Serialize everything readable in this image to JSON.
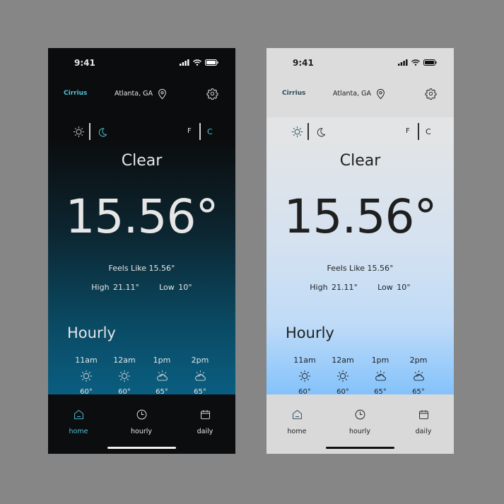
{
  "status": {
    "time": "9:41"
  },
  "header": {
    "app_name": "Cirrius",
    "location": "Atlanta, GA"
  },
  "units": {
    "f": "F",
    "c": "C"
  },
  "weather": {
    "condition": "Clear",
    "temperature": "15.56°",
    "feels_like": "Feels Like  15.56°",
    "high": "High  21.11°",
    "low": "Low  10°"
  },
  "hourly": {
    "title": "Hourly",
    "items": [
      {
        "time": "11am",
        "icon": "sun-icon",
        "temp": "60°"
      },
      {
        "time": "12am",
        "icon": "sun-icon",
        "temp": "60°"
      },
      {
        "time": "1pm",
        "icon": "partly-cloudy-icon",
        "temp": "65°"
      },
      {
        "time": "2pm",
        "icon": "partly-cloudy-icon",
        "temp": "65°"
      }
    ]
  },
  "nav": {
    "home": "home",
    "hourly": "hourly",
    "daily": "daily"
  },
  "themes": {
    "dark": {
      "text": "#e6e6e6",
      "accent": "#4fc3d9",
      "background": "#0b0c0d"
    },
    "light": {
      "text": "#1f1f1f",
      "accent": "#2a4a5a",
      "background": "#e2e3e5"
    }
  }
}
